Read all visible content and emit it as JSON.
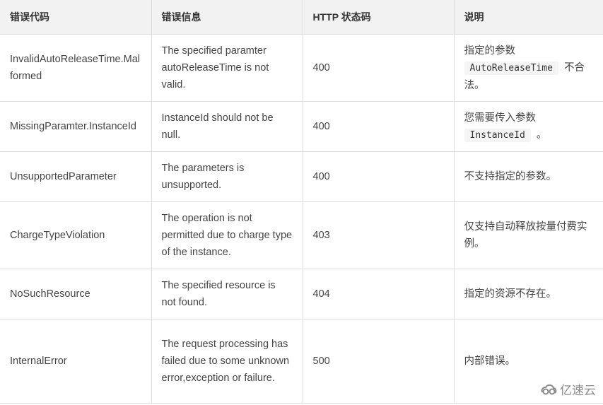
{
  "table": {
    "headers": [
      "错误代码",
      "错误信息",
      "HTTP 状态码",
      "说明"
    ],
    "rows": [
      {
        "code": "InvalidAutoReleaseTime.Malformed",
        "message": "The specified paramter autoReleaseTime is not valid.",
        "status": "400",
        "desc_pre": "指定的参数",
        "desc_code": "AutoReleaseTime",
        "desc_post": "不合法。"
      },
      {
        "code": "MissingParamter.InstanceId",
        "message": "InstanceId should not be null.",
        "status": "400",
        "desc_pre": "您需要传入参数",
        "desc_code": "InstanceId",
        "desc_post": "。"
      },
      {
        "code": "UnsupportedParameter",
        "message": "The parameters is unsupported.",
        "status": "400",
        "desc_pre": "不支持指定的参数。"
      },
      {
        "code": "ChargeTypeViolation",
        "message": "The operation is not permitted due to charge type of the instance.",
        "status": "403",
        "desc_pre": "仅支持自动释放按量付费实例。"
      },
      {
        "code": "NoSuchResource",
        "message": "The specified resource is not found.",
        "status": "404",
        "desc_pre": "指定的资源不存在。"
      },
      {
        "code": "InternalError",
        "message": "The request processing has failed due to some unknown error,exception or failure.",
        "status": "500",
        "desc_pre": "内部错误。"
      }
    ]
  },
  "watermark": {
    "icon": "cloud-logo-icon",
    "text": "亿速云"
  }
}
